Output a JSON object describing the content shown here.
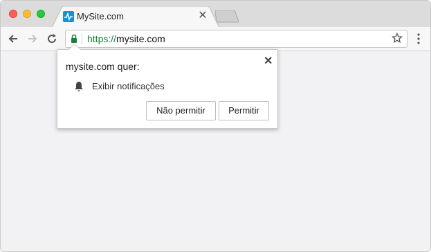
{
  "tab": {
    "title": "MySite.com",
    "favicon": "site-favicon",
    "close_glyph": "✕"
  },
  "address_bar": {
    "scheme": "https://",
    "host": "mysite.com"
  },
  "popup": {
    "heading": "mysite.com quer:",
    "permission_label": "Exibir notificações",
    "deny_label": "Não permitir",
    "allow_label": "Permitir",
    "close_glyph": "✕"
  },
  "colors": {
    "secure": "#188038",
    "favicon": "#1a8fd6"
  }
}
